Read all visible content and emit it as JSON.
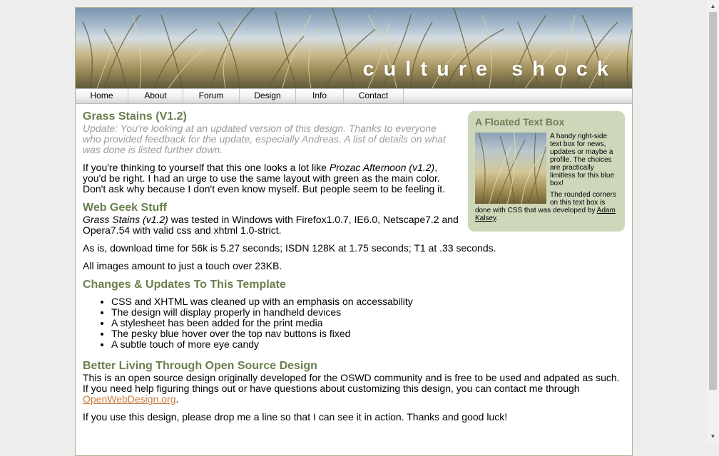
{
  "banner": {
    "title": "culture shock"
  },
  "nav": {
    "items": [
      "Home",
      "About",
      "Forum",
      "Design",
      "Info",
      "Contact"
    ]
  },
  "intro": {
    "heading": "Grass Stains (V1.2)",
    "update": "Update: You're looking at an updated version of this design. Thanks to everyone who provided feedback for the update, especially Andreas. A list of details on what was done is listed further down.",
    "p1_pre": "If you're thinking to yourself that this one looks a lot like ",
    "p1_em": "Prozac Afternoon (v1.2)",
    "p1_post": ", you'd be right. I had an urge to use the same layout with green as the main color. Don't ask why because I don't even know myself. But people seem to be feeling it."
  },
  "geek": {
    "heading": "Web Geek Stuff",
    "p1_em": "Grass Stains (v1.2)",
    "p1_post": " was tested in Windows with Firefox1.0.7, IE6.0, Netscape7.2 and Opera7.54 with valid css and xhtml 1.0-strict.",
    "p2": "As is, download time for 56k is 5.27 seconds; ISDN 128K at 1.75 seconds; T1 at .33 seconds.",
    "p3": "All images amount to just a touch over 23KB."
  },
  "changes": {
    "heading": "Changes & Updates To This Template",
    "items": [
      "CSS and XHTML was cleaned up with an emphasis on accessability",
      "The design will display properly in handheld devices",
      "A stylesheet has been added for the print media",
      "The pesky blue hover over the top nav buttons is fixed",
      "A subtle touch of more eye candy"
    ]
  },
  "opensource": {
    "heading": "Better Living Through Open Source Design",
    "p1_pre": "This is an open source design originally developed for the OSWD community and is free to be used and adpated as such. If you need help figuring things out or have questions about customizing this design, you can contact me through ",
    "p1_link": "OpenWebDesign.org",
    "p1_post": ".",
    "p2": "If you use this design, please drop me a line so that I can see it in action. Thanks and good luck!"
  },
  "floatbox": {
    "title": "A Floated Text Box",
    "p1": "A handy right-side text box for news, updates or maybe a profile. The choices are practically limitless for this blue box!",
    "p2_pre": "The rounded corners on this text box is done with CSS that was developed by ",
    "p2_link": "Adam Kalsey",
    "p2_post": "."
  },
  "colors": {
    "accent": "#6a7f4f",
    "box_bg": "#cfd7bb",
    "link": "#c87a3c"
  }
}
